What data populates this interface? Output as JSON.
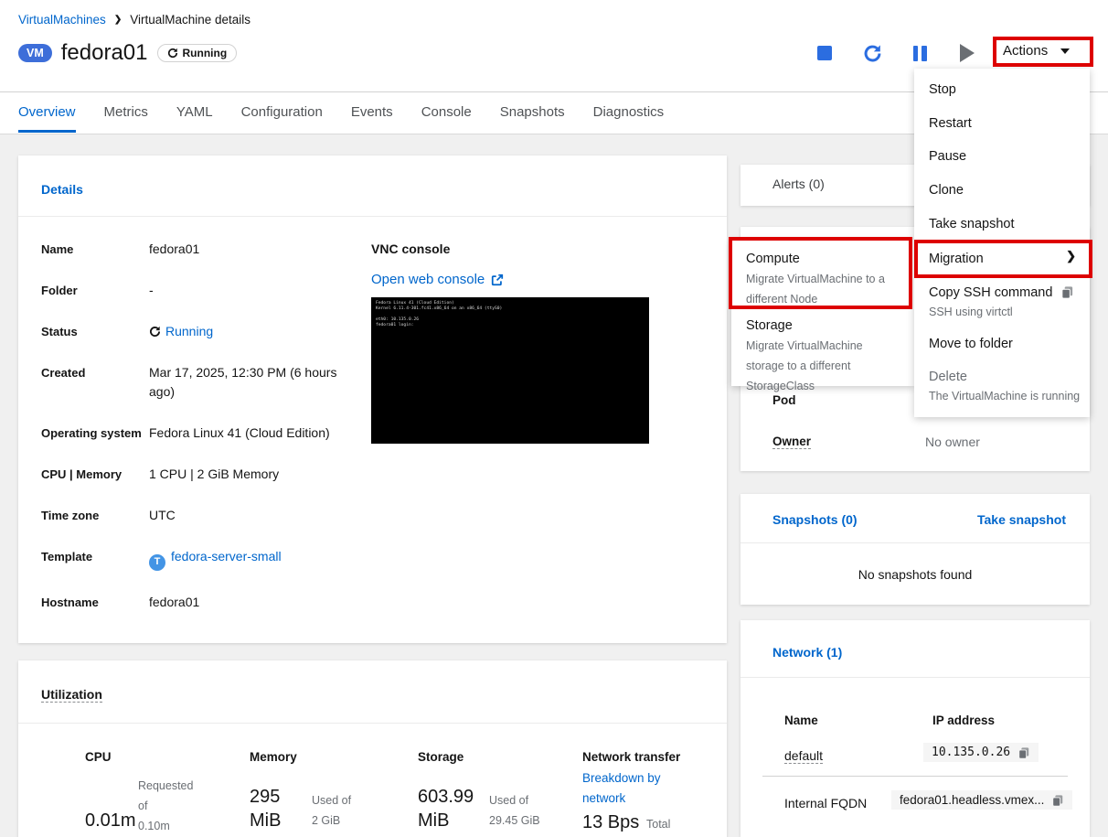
{
  "colors": {
    "accent": "#0066cc",
    "annotation_red": "#dd0000",
    "icon_blue": "#2b6de0",
    "icon_gray": "#6a6e73",
    "vm_badge_blue": "#3d6ed9",
    "template_badge_blue": "#4394e5"
  },
  "breadcrumb": {
    "parent": "VirtualMachines",
    "current": "VirtualMachine details"
  },
  "header": {
    "badge": "VM",
    "title": "fedora01",
    "status": "Running",
    "actions_label": "Actions"
  },
  "tabs": [
    {
      "label": "Overview",
      "active": true
    },
    {
      "label": "Metrics"
    },
    {
      "label": "YAML"
    },
    {
      "label": "Configuration"
    },
    {
      "label": "Events"
    },
    {
      "label": "Console"
    },
    {
      "label": "Snapshots"
    },
    {
      "label": "Diagnostics"
    }
  ],
  "details": {
    "title": "Details",
    "rows": [
      {
        "label": "Name",
        "value": "fedora01"
      },
      {
        "label": "Folder",
        "value": "-"
      },
      {
        "label": "Status",
        "value": "Running"
      },
      {
        "label": "Created",
        "value": "Mar 17, 2025, 12:30 PM (6 hours ago)"
      },
      {
        "label": "Operating system",
        "value": "Fedora Linux 41 (Cloud Edition)"
      },
      {
        "label": "CPU | Memory",
        "value": "1 CPU | 2 GiB Memory"
      },
      {
        "label": "Time zone",
        "value": "UTC"
      },
      {
        "label": "Template",
        "value": "fedora-server-small"
      },
      {
        "label": "Hostname",
        "value": "fedora01"
      }
    ],
    "vnc": {
      "title": "VNC console",
      "open_link": "Open web console",
      "console_text": "Fedora Linux 41 (Cloud Edition)\nKernel 6.11.4-301.fc41.x86_64 on an x86_64 (ttyS0)\n\neth0: 10.135.0.26\nfedora01 login:"
    }
  },
  "utilization": {
    "title": "Utilization",
    "metrics": [
      {
        "title": "CPU",
        "value": "0.01m",
        "caption": "Requested\nof\n0.10m"
      },
      {
        "title": "Memory",
        "value": "295\nMiB",
        "caption": "Used of\n2 GiB"
      },
      {
        "title": "Storage",
        "value": "603.99\nMiB",
        "caption": "Used of\n29.45 GiB"
      },
      {
        "title": "Network transfer",
        "link": "Breakdown by\nnetwork",
        "value": "13 Bps",
        "caption": "Total"
      }
    ]
  },
  "alerts": {
    "title": "Alerts (0)"
  },
  "general": {
    "pod_label": "Pod",
    "owner_label": "Owner",
    "owner_value": "No owner"
  },
  "snapshots": {
    "title": "Snapshots (0)",
    "action": "Take snapshot",
    "empty_text": "No snapshots found"
  },
  "network": {
    "title": "Network (1)",
    "col_name": "Name",
    "col_ip": "IP address",
    "row_name": "default",
    "row_ip": "10.135.0.26",
    "fqdn_label": "Internal FQDN",
    "fqdn_value": "fedora01.headless.vmex..."
  },
  "actions_menu": {
    "items": [
      {
        "label": "Stop"
      },
      {
        "label": "Restart"
      },
      {
        "label": "Pause"
      },
      {
        "label": "Clone"
      },
      {
        "label": "Take snapshot"
      },
      {
        "label": "Migration"
      },
      {
        "label": "Copy SSH command",
        "description": "SSH using virtctl"
      },
      {
        "label": "Move to folder"
      },
      {
        "label": "Delete",
        "description": "The VirtualMachine is running"
      }
    ]
  },
  "migration_submenu": {
    "items": [
      {
        "label": "Compute",
        "description": "Migrate VirtualMachine to a different Node"
      },
      {
        "label": "Storage",
        "description": "Migrate VirtualMachine storage to a different StorageClass"
      }
    ]
  }
}
